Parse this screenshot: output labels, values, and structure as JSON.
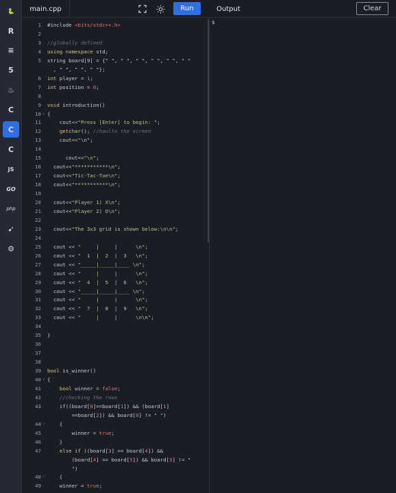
{
  "sidebar": {
    "items": [
      {
        "name": "python-icon",
        "glyph": "🐍",
        "active": false
      },
      {
        "name": "r-icon",
        "glyph": "R",
        "active": false
      },
      {
        "name": "sql-database-icon",
        "glyph": "≡",
        "active": false
      },
      {
        "name": "html5-icon",
        "glyph": "5",
        "active": false
      },
      {
        "name": "java-icon",
        "glyph": "♨",
        "active": false
      },
      {
        "name": "c-icon",
        "glyph": "C",
        "active": false
      },
      {
        "name": "cpp-icon",
        "glyph": "C",
        "active": true
      },
      {
        "name": "csharp-icon",
        "glyph": "C",
        "active": false
      },
      {
        "name": "javascript-icon",
        "glyph": "JS",
        "active": false
      },
      {
        "name": "go-icon",
        "glyph": "GO",
        "active": false
      },
      {
        "name": "php-icon",
        "glyph": "php",
        "active": false
      },
      {
        "name": "swift-icon",
        "glyph": "➹",
        "active": false
      },
      {
        "name": "rust-icon",
        "glyph": "⚙",
        "active": false
      }
    ]
  },
  "toolbar": {
    "file_tab": "main.cpp",
    "run_label": "Run",
    "output_label": "Output",
    "clear_label": "Clear",
    "fullscreen_icon": "fullscreen-icon",
    "theme_icon": "sun-icon"
  },
  "output": {
    "prompt": "$"
  },
  "colors": {
    "accent": "#2f6fe0",
    "background": "#1b1d25",
    "keyword": "#d8c37a",
    "string": "#b9c48a",
    "comment": "#6d7282",
    "number": "#e07a6a"
  },
  "code_lines": [
    {
      "n": "1",
      "fold": false,
      "segs": [
        [
          "p",
          "#include "
        ],
        [
          "inc",
          "<bits/stdc++.h>"
        ]
      ]
    },
    {
      "n": "2",
      "fold": false,
      "segs": []
    },
    {
      "n": "3",
      "fold": false,
      "segs": [
        [
          "c",
          "//globally defined"
        ]
      ]
    },
    {
      "n": "4",
      "fold": false,
      "segs": [
        [
          "k",
          "using namespace"
        ],
        [
          "p",
          " std;"
        ]
      ]
    },
    {
      "n": "5",
      "fold": false,
      "segs": [
        [
          "p",
          "string board[9] = {\" \", \" \", \" \", \" \", \" \", \" \""
        ]
      ]
    },
    {
      "n": "",
      "fold": false,
      "segs": [
        [
          "p",
          "  , \" \", \" \", \" \"};"
        ]
      ]
    },
    {
      "n": "6",
      "fold": false,
      "segs": [
        [
          "t",
          "int"
        ],
        [
          "p",
          " player = "
        ],
        [
          "n",
          "1"
        ],
        [
          "p",
          ";"
        ]
      ]
    },
    {
      "n": "7",
      "fold": false,
      "segs": [
        [
          "t",
          "int"
        ],
        [
          "p",
          " position = "
        ],
        [
          "n",
          "0"
        ],
        [
          "p",
          ";"
        ]
      ]
    },
    {
      "n": "8",
      "fold": false,
      "segs": []
    },
    {
      "n": "9",
      "fold": false,
      "segs": [
        [
          "t",
          "void"
        ],
        [
          "p",
          " introduction()"
        ]
      ]
    },
    {
      "n": "10",
      "fold": true,
      "segs": [
        [
          "p",
          "{"
        ]
      ]
    },
    {
      "n": "11",
      "fold": false,
      "segs": [
        [
          "p",
          "    cout<<"
        ],
        [
          "s",
          "\"Press [Enter] to begin: \""
        ],
        [
          "p",
          ";"
        ]
      ]
    },
    {
      "n": "12",
      "fold": false,
      "segs": [
        [
          "p",
          "    "
        ],
        [
          "k",
          "getchar"
        ],
        [
          "p",
          "(); "
        ],
        [
          "c",
          "//haults the screen"
        ]
      ]
    },
    {
      "n": "13",
      "fold": false,
      "segs": [
        [
          "p",
          "    cout<<"
        ],
        [
          "s",
          "\"\\n\""
        ],
        [
          "p",
          ";"
        ]
      ]
    },
    {
      "n": "14",
      "fold": false,
      "segs": []
    },
    {
      "n": "15",
      "fold": false,
      "segs": [
        [
          "p",
          "      cout<<"
        ],
        [
          "s",
          "\"\\n\""
        ],
        [
          "p",
          ";"
        ]
      ]
    },
    {
      "n": "16",
      "fold": false,
      "segs": [
        [
          "p",
          "  cout<<"
        ],
        [
          "s",
          "\"***********\\n\""
        ],
        [
          "p",
          ";"
        ]
      ]
    },
    {
      "n": "17",
      "fold": false,
      "segs": [
        [
          "p",
          "  cout<<"
        ],
        [
          "s",
          "\"Tic-Tac-Toe\\n\""
        ],
        [
          "p",
          ";"
        ]
      ]
    },
    {
      "n": "18",
      "fold": false,
      "segs": [
        [
          "p",
          "  cout<<"
        ],
        [
          "s",
          "\"***********\\n\""
        ],
        [
          "p",
          ";"
        ]
      ]
    },
    {
      "n": "19",
      "fold": false,
      "segs": []
    },
    {
      "n": "20",
      "fold": false,
      "segs": [
        [
          "p",
          "  cout<<"
        ],
        [
          "s",
          "\"Player 1) X\\n\""
        ],
        [
          "p",
          ";"
        ]
      ]
    },
    {
      "n": "21",
      "fold": false,
      "segs": [
        [
          "p",
          "  cout<<"
        ],
        [
          "s",
          "\"Player 2) O\\n\""
        ],
        [
          "p",
          ";"
        ]
      ]
    },
    {
      "n": "22",
      "fold": false,
      "segs": []
    },
    {
      "n": "23",
      "fold": false,
      "segs": [
        [
          "p",
          "  cout<<"
        ],
        [
          "s",
          "\"The 3x3 grid is shown below:\\n\\n\""
        ],
        [
          "p",
          ";"
        ]
      ]
    },
    {
      "n": "24",
      "fold": false,
      "segs": []
    },
    {
      "n": "25",
      "fold": false,
      "segs": [
        [
          "p",
          "  cout << "
        ],
        [
          "s",
          "\"     |     |      \\n\""
        ],
        [
          "p",
          ";"
        ]
      ]
    },
    {
      "n": "26",
      "fold": false,
      "segs": [
        [
          "p",
          "  cout << "
        ],
        [
          "s",
          "\"  1  |  2  |  3   \\n\""
        ],
        [
          "p",
          ";"
        ]
      ]
    },
    {
      "n": "27",
      "fold": false,
      "segs": [
        [
          "p",
          "  cout << "
        ],
        [
          "s",
          "\"_____|_____|____ \\n\""
        ],
        [
          "p",
          ";"
        ]
      ]
    },
    {
      "n": "28",
      "fold": false,
      "segs": [
        [
          "p",
          "  cout << "
        ],
        [
          "s",
          "\"     |     |      \\n\""
        ],
        [
          "p",
          ";"
        ]
      ]
    },
    {
      "n": "29",
      "fold": false,
      "segs": [
        [
          "p",
          "  cout << "
        ],
        [
          "s",
          "\"  4  |  5  |  6   \\n\""
        ],
        [
          "p",
          ";"
        ]
      ]
    },
    {
      "n": "30",
      "fold": false,
      "segs": [
        [
          "p",
          "  cout << "
        ],
        [
          "s",
          "\"_____|_____|____ \\n\""
        ],
        [
          "p",
          ";"
        ]
      ]
    },
    {
      "n": "31",
      "fold": false,
      "segs": [
        [
          "p",
          "  cout << "
        ],
        [
          "s",
          "\"     |     |      \\n\""
        ],
        [
          "p",
          ";"
        ]
      ]
    },
    {
      "n": "32",
      "fold": false,
      "segs": [
        [
          "p",
          "  cout << "
        ],
        [
          "s",
          "\"  7  |  8  |  9   \\n\""
        ],
        [
          "p",
          ";"
        ]
      ]
    },
    {
      "n": "33",
      "fold": false,
      "segs": [
        [
          "p",
          "  cout << "
        ],
        [
          "s",
          "\"     |     |      \\n\\n\""
        ],
        [
          "p",
          ";"
        ]
      ]
    },
    {
      "n": "34",
      "fold": false,
      "segs": []
    },
    {
      "n": "35",
      "fold": false,
      "segs": [
        [
          "p",
          "}"
        ]
      ]
    },
    {
      "n": "36",
      "fold": false,
      "segs": []
    },
    {
      "n": "37",
      "fold": false,
      "segs": []
    },
    {
      "n": "38",
      "fold": false,
      "segs": []
    },
    {
      "n": "39",
      "fold": false,
      "segs": [
        [
          "t",
          "bool"
        ],
        [
          "p",
          " is_winner()"
        ]
      ]
    },
    {
      "n": "40",
      "fold": true,
      "segs": [
        [
          "p",
          "{"
        ]
      ]
    },
    {
      "n": "41",
      "fold": false,
      "segs": [
        [
          "p",
          "    "
        ],
        [
          "t",
          "bool"
        ],
        [
          "p",
          " winner = "
        ],
        [
          "n",
          "false"
        ],
        [
          "p",
          ";"
        ]
      ]
    },
    {
      "n": "42",
      "fold": false,
      "segs": [
        [
          "c",
          "    //checking the rows"
        ]
      ]
    },
    {
      "n": "43",
      "fold": false,
      "segs": [
        [
          "p",
          "    "
        ],
        [
          "k",
          "if"
        ],
        [
          "p",
          "((board["
        ],
        [
          "n",
          "0"
        ],
        [
          "p",
          "]==board["
        ],
        [
          "n",
          "1"
        ],
        [
          "p",
          "]) && (board["
        ],
        [
          "n",
          "1"
        ],
        [
          "p",
          "]"
        ]
      ]
    },
    {
      "n": "",
      "fold": false,
      "segs": [
        [
          "p",
          "        ==board["
        ],
        [
          "n",
          "2"
        ],
        [
          "p",
          "]) && board["
        ],
        [
          "n",
          "0"
        ],
        [
          "p",
          "] != "
        ],
        [
          "s",
          "\" \""
        ],
        [
          "p",
          ")"
        ]
      ]
    },
    {
      "n": "44",
      "fold": true,
      "segs": [
        [
          "p",
          "    {"
        ]
      ]
    },
    {
      "n": "45",
      "fold": false,
      "segs": [
        [
          "p",
          "        winner = "
        ],
        [
          "n",
          "true"
        ],
        [
          "p",
          ";"
        ]
      ]
    },
    {
      "n": "46",
      "fold": false,
      "segs": [
        [
          "p",
          "    }"
        ]
      ]
    },
    {
      "n": "47",
      "fold": false,
      "segs": [
        [
          "p",
          "    "
        ],
        [
          "k",
          "else if"
        ],
        [
          "p",
          " ((board["
        ],
        [
          "n",
          "3"
        ],
        [
          "p",
          "] == board["
        ],
        [
          "n",
          "4"
        ],
        [
          "p",
          "]) &&"
        ]
      ]
    },
    {
      "n": "",
      "fold": false,
      "segs": [
        [
          "p",
          "        (board["
        ],
        [
          "n",
          "4"
        ],
        [
          "p",
          "] == board["
        ],
        [
          "n",
          "5"
        ],
        [
          "p",
          "]) && board["
        ],
        [
          "n",
          "3"
        ],
        [
          "p",
          "] != "
        ],
        [
          "s",
          "\""
        ]
      ]
    },
    {
      "n": "",
      "fold": false,
      "segs": [
        [
          "s",
          "        \""
        ],
        [
          "p",
          ")"
        ]
      ]
    },
    {
      "n": "48",
      "fold": true,
      "segs": [
        [
          "p",
          "    {"
        ]
      ]
    },
    {
      "n": "49",
      "fold": false,
      "segs": [
        [
          "p",
          "    winner = "
        ],
        [
          "n",
          "true"
        ],
        [
          "p",
          ";"
        ]
      ]
    }
  ]
}
